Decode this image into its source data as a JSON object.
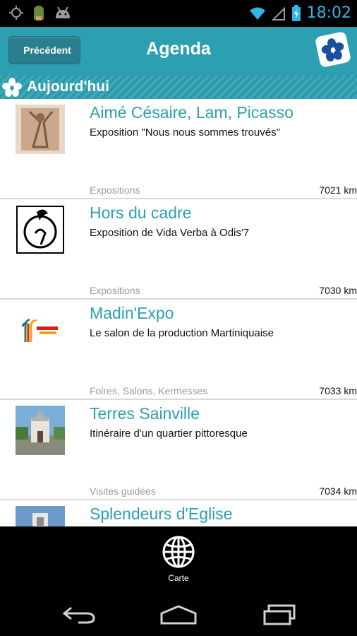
{
  "status_bar": {
    "time": "18:02"
  },
  "header": {
    "back_label": "Précédent",
    "title": "Agenda",
    "logo_icon": "hibiscus-icon"
  },
  "section": {
    "title": "Aujourd'hui"
  },
  "events": [
    {
      "title": "Aimé Césaire, Lam, Picasso",
      "description": "Exposition \"Nous nous sommes trouvés\"",
      "category": "Expositions",
      "distance": "7021 km"
    },
    {
      "title": "Hors du cadre",
      "description": "Exposition de Vida Verba à Odis'7",
      "category": "Expositions",
      "distance": "7030 km"
    },
    {
      "title": "Madin'Expo",
      "description": "Le salon de la production Martiniquaise",
      "category": "Foires, Salons, Kermesses",
      "distance": "7033 km"
    },
    {
      "title": "Terres Sainville",
      "description": "Itinéraire d'un quartier pittoresque",
      "category": "Visites guidées",
      "distance": "7034 km"
    },
    {
      "title": "Splendeurs d'Eglise",
      "description": "",
      "category": "",
      "distance": ""
    }
  ],
  "bottom_bar": {
    "map_label": "Carte"
  },
  "colors": {
    "accent": "#2c9fb0",
    "status_time": "#33b5e5"
  }
}
